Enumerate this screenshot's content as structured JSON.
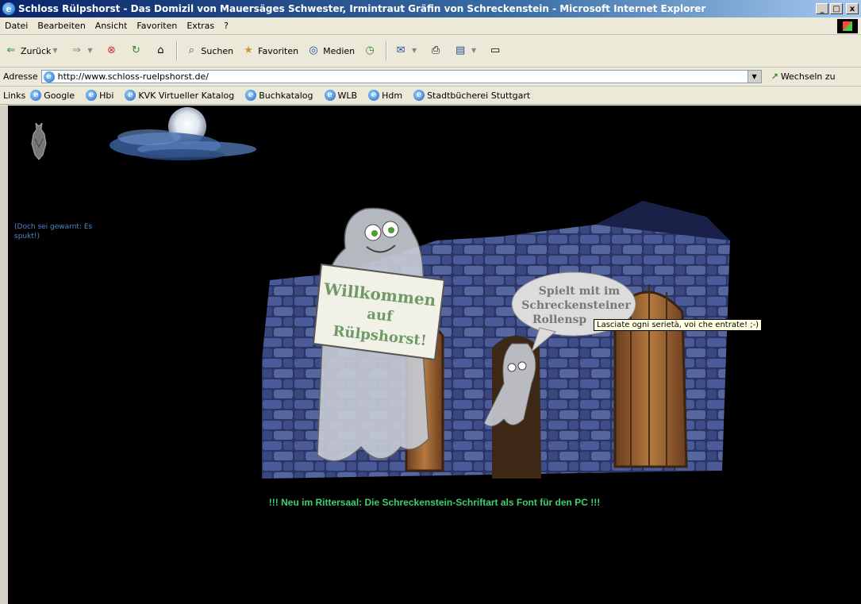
{
  "window": {
    "title": "Schloss Rülpshorst - Das Domizil von Mauersäges Schwester, Irmintraut Gräfin von Schreckenstein - Microsoft Internet Explorer",
    "controls": {
      "minimize": "_",
      "maximize": "□",
      "close": "x"
    }
  },
  "menu": [
    "Datei",
    "Bearbeiten",
    "Ansicht",
    "Favoriten",
    "Extras",
    "?"
  ],
  "toolbar": {
    "back": "Zurück",
    "forward_icon": "arrow-right-icon",
    "search": "Suchen",
    "favorites": "Favoriten",
    "media": "Medien"
  },
  "address": {
    "label": "Adresse",
    "url": "http://www.schloss-ruelpshorst.de/",
    "go": "Wechseln zu"
  },
  "links": {
    "label": "Links",
    "items": [
      "Google",
      "Hbi",
      "KVK Virtueller Katalog",
      "Buchkatalog",
      "WLB",
      "Hdm",
      "Stadtbücherei Stuttgart"
    ]
  },
  "page": {
    "warning": "(Doch sei gewarnt: Es spukt!)",
    "sign_line1": "Willkommen",
    "sign_line2": "auf",
    "sign_line3": "Rülpshorst!",
    "bubble_line1": "Spielt mit im",
    "bubble_line2": "Schreckensteiner",
    "bubble_line3": "Rollensp",
    "tooltip": "Lasciate ogni serietà, voi che entrate! ;-)",
    "news": "!!! Neu im Rittersaal: Die Schreckenstein-Schriftart als Font für den PC !!!"
  },
  "colors": {
    "titlebar": "#0a246a",
    "page_bg": "#000000",
    "news_text": "#3fcf6e",
    "warning_text": "#4d86c5",
    "tooltip_bg": "#ffffe1"
  }
}
